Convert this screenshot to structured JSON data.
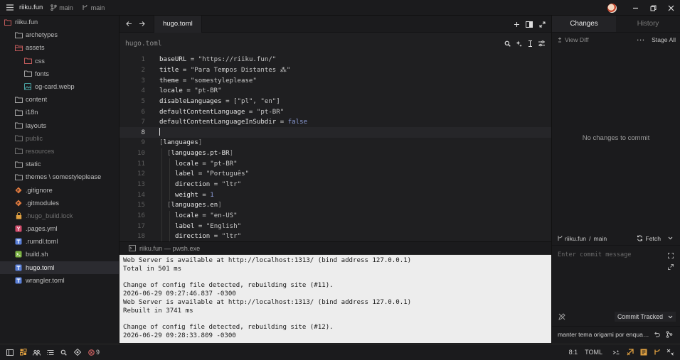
{
  "titlebar": {
    "project": "riiku.fun",
    "branch1": "main",
    "branch2": "main"
  },
  "sidebar": {
    "root": "riiku.fun",
    "items": [
      {
        "label": "archetypes",
        "kind": "folder",
        "color": "#a3a3a3",
        "depth": 1,
        "dim": false
      },
      {
        "label": "assets",
        "kind": "folder-open",
        "color": "#c05a5a",
        "depth": 1,
        "dim": false
      },
      {
        "label": "css",
        "kind": "folder",
        "color": "#c05a5a",
        "depth": 2,
        "dim": false
      },
      {
        "label": "fonts",
        "kind": "folder",
        "color": "#a3a3a3",
        "depth": 2,
        "dim": false
      },
      {
        "label": "og-card.webp",
        "kind": "image",
        "color": "#4aa3a3",
        "depth": 2,
        "dim": false
      },
      {
        "label": "content",
        "kind": "folder",
        "color": "#a3a3a3",
        "depth": 1,
        "dim": false
      },
      {
        "label": "i18n",
        "kind": "folder",
        "color": "#a3a3a3",
        "depth": 1,
        "dim": false
      },
      {
        "label": "layouts",
        "kind": "folder",
        "color": "#a3a3a3",
        "depth": 1,
        "dim": false
      },
      {
        "label": "public",
        "kind": "folder",
        "color": "#6f6f6f",
        "depth": 1,
        "dim": true
      },
      {
        "label": "resources",
        "kind": "folder",
        "color": "#6f6f6f",
        "depth": 1,
        "dim": true
      },
      {
        "label": "static",
        "kind": "folder",
        "color": "#a3a3a3",
        "depth": 1,
        "dim": false
      },
      {
        "label": "themes \\ somestyleplease",
        "kind": "folder",
        "color": "#a3a3a3",
        "depth": 1,
        "dim": false
      },
      {
        "label": ".gitignore",
        "kind": "git",
        "color": "#e07a3e",
        "depth": 1,
        "dim": false
      },
      {
        "label": ".gitmodules",
        "kind": "git",
        "color": "#e07a3e",
        "depth": 1,
        "dim": false
      },
      {
        "label": ".hugo_build.lock",
        "kind": "lock",
        "color": "#e0a040",
        "depth": 1,
        "dim": true
      },
      {
        "label": ".pages.yml",
        "kind": "yml",
        "color": "#d24b6b",
        "depth": 1,
        "dim": false
      },
      {
        "label": ".rumdl.toml",
        "kind": "toml",
        "color": "#5a7fd8",
        "depth": 1,
        "dim": false
      },
      {
        "label": "build.sh",
        "kind": "sh",
        "color": "#7cb342",
        "depth": 1,
        "dim": false
      },
      {
        "label": "hugo.toml",
        "kind": "toml",
        "color": "#5a7fd8",
        "depth": 1,
        "dim": false,
        "selected": true
      },
      {
        "label": "wrangler.toml",
        "kind": "toml",
        "color": "#5a7fd8",
        "depth": 1,
        "dim": false
      }
    ]
  },
  "editor": {
    "tab_label": "hugo.toml",
    "breadcrumb": "hugo.toml",
    "active_line": 8,
    "lines": [
      {
        "n": "1",
        "indent": 0,
        "parts": [
          [
            "k",
            "baseURL"
          ],
          [
            "p",
            " = "
          ],
          [
            "s",
            "\"https://riiku.fun/\""
          ]
        ]
      },
      {
        "n": "2",
        "indent": 0,
        "parts": [
          [
            "k",
            "title"
          ],
          [
            "p",
            " = "
          ],
          [
            "s",
            "\"Para Tempos Distantes ⁂\""
          ]
        ]
      },
      {
        "n": "3",
        "indent": 0,
        "parts": [
          [
            "k",
            "theme"
          ],
          [
            "p",
            " = "
          ],
          [
            "s",
            "\"somestyleplease\""
          ]
        ]
      },
      {
        "n": "4",
        "indent": 0,
        "parts": [
          [
            "k",
            "locale"
          ],
          [
            "p",
            " = "
          ],
          [
            "s",
            "\"pt-BR\""
          ]
        ]
      },
      {
        "n": "5",
        "indent": 0,
        "parts": [
          [
            "k",
            "disableLanguages"
          ],
          [
            "p",
            " = "
          ],
          [
            "s",
            "[\"pl\", \"en\"]"
          ]
        ]
      },
      {
        "n": "6",
        "indent": 0,
        "parts": [
          [
            "k",
            "defaultContentLanguage"
          ],
          [
            "p",
            " = "
          ],
          [
            "s",
            "\"pt-BR\""
          ]
        ]
      },
      {
        "n": "7",
        "indent": 0,
        "parts": [
          [
            "k",
            "defaultContentLanguageInSubdir"
          ],
          [
            "p",
            " = "
          ],
          [
            "v",
            "false"
          ]
        ]
      },
      {
        "n": "8",
        "indent": 0,
        "parts": []
      },
      {
        "n": "9",
        "indent": 0,
        "parts": [
          [
            "b",
            "["
          ],
          [
            "h",
            "languages"
          ],
          [
            "b",
            "]"
          ]
        ]
      },
      {
        "n": "10",
        "indent": 1,
        "parts": [
          [
            "b",
            "["
          ],
          [
            "h",
            "languages.pt-BR"
          ],
          [
            "b",
            "]"
          ]
        ]
      },
      {
        "n": "11",
        "indent": 2,
        "parts": [
          [
            "k",
            "locale"
          ],
          [
            "p",
            " = "
          ],
          [
            "s",
            "\"pt-BR\""
          ]
        ]
      },
      {
        "n": "12",
        "indent": 2,
        "parts": [
          [
            "k",
            "label"
          ],
          [
            "p",
            " = "
          ],
          [
            "s",
            "\"Português\""
          ]
        ]
      },
      {
        "n": "13",
        "indent": 2,
        "parts": [
          [
            "k",
            "direction"
          ],
          [
            "p",
            " = "
          ],
          [
            "s",
            "\"ltr\""
          ]
        ]
      },
      {
        "n": "14",
        "indent": 2,
        "parts": [
          [
            "k",
            "weight"
          ],
          [
            "p",
            " = "
          ],
          [
            "v",
            "1"
          ]
        ]
      },
      {
        "n": "15",
        "indent": 1,
        "parts": [
          [
            "b",
            "["
          ],
          [
            "h",
            "languages.en"
          ],
          [
            "b",
            "]"
          ]
        ]
      },
      {
        "n": "16",
        "indent": 2,
        "parts": [
          [
            "k",
            "locale"
          ],
          [
            "p",
            " = "
          ],
          [
            "s",
            "\"en-US\""
          ]
        ]
      },
      {
        "n": "17",
        "indent": 2,
        "parts": [
          [
            "k",
            "label"
          ],
          [
            "p",
            " = "
          ],
          [
            "s",
            "\"English\""
          ]
        ]
      },
      {
        "n": "18",
        "indent": 2,
        "parts": [
          [
            "k",
            "direction"
          ],
          [
            "p",
            " = "
          ],
          [
            "s",
            "\"ltr\""
          ]
        ]
      }
    ]
  },
  "terminal": {
    "tab_label": "riiku.fun — pwsh.exe",
    "lines": [
      "Web Server is available at http://localhost:1313/ (bind address 127.0.0.1)",
      "Total in 501 ms",
      "",
      "Change of config file detected, rebuilding site (#11).",
      "2026-06-29 09:27:46.837 -0300",
      "Web Server is available at http://localhost:1313/ (bind address 127.0.0.1)",
      "Rebuilt in 3741 ms",
      "",
      "Change of config file detected, rebuilding site (#12).",
      "2026-06-29 09:28:33.809 -0300"
    ]
  },
  "git_panel": {
    "tab_changes": "Changes",
    "tab_history": "History",
    "view_diff": "View Diff",
    "stage_all": "Stage All",
    "empty_message": "No changes to commit",
    "repo": "riiku.fun",
    "branch": "main",
    "fetch": "Fetch",
    "commit_placeholder": "Enter commit message",
    "commit_button": "Commit Tracked",
    "last_commit": "manter tema origami por enquanto"
  },
  "statusbar": {
    "diagnostics_count": "9",
    "cursor_position": "8:1",
    "language": "TOML"
  }
}
